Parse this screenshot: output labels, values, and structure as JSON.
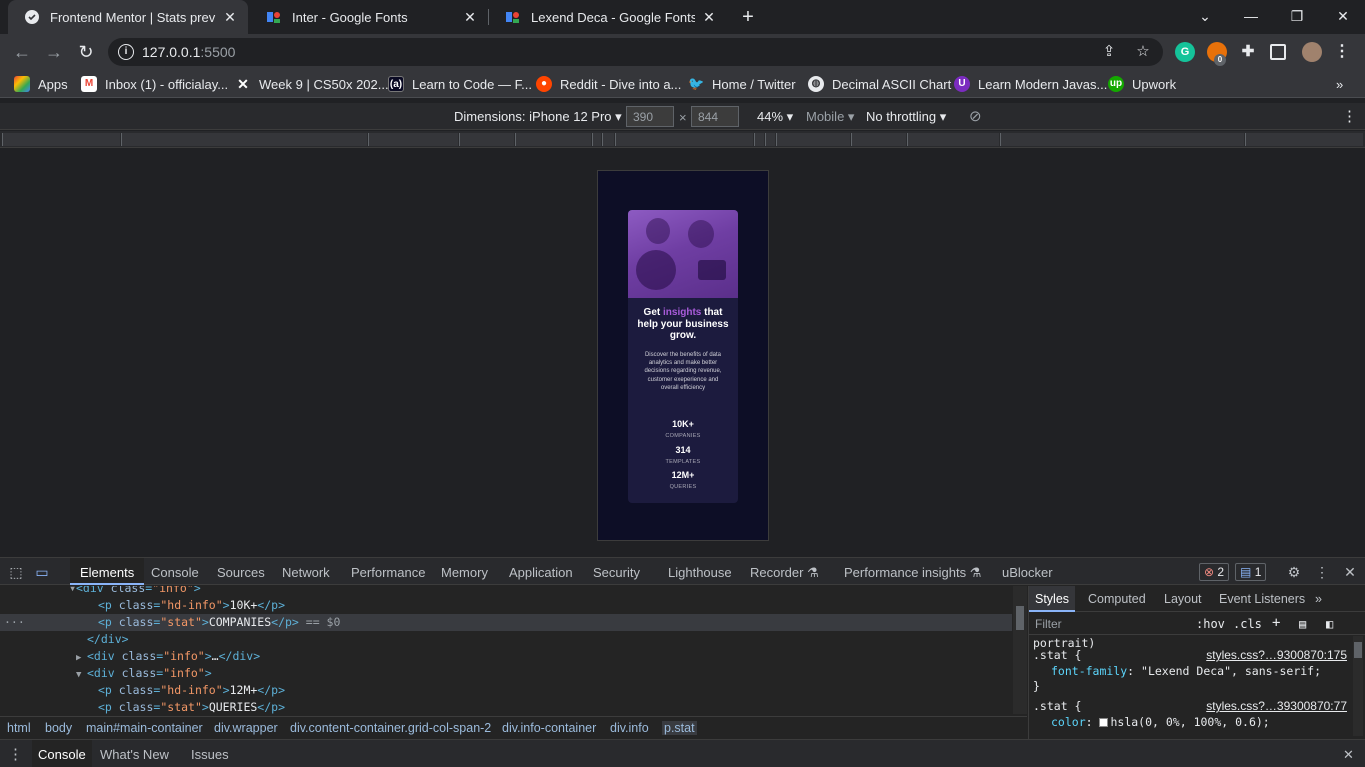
{
  "browser": {
    "tabs": [
      {
        "title": "Frontend Mentor | Stats preview c",
        "favicon": "globe-icon",
        "active": true
      },
      {
        "title": "Inter - Google Fonts",
        "favicon": "google-fonts-icon",
        "active": false
      },
      {
        "title": "Lexend Deca - Google Fonts",
        "favicon": "google-fonts-icon",
        "active": false
      }
    ],
    "new_tab": "+",
    "url_host": "127.0.0.1",
    "url_port": ":5500",
    "extension_badge": "0",
    "bookmarks": [
      {
        "label": "Apps",
        "icon": "apps-grid-icon"
      },
      {
        "label": "Inbox (1) - officialay...",
        "icon": "gmail-icon"
      },
      {
        "label": "Week 9 | CS50x 202...",
        "icon": "x-icon"
      },
      {
        "label": "Learn to Code — F...",
        "icon": "freecodecamp-icon"
      },
      {
        "label": "Reddit - Dive into a...",
        "icon": "reddit-icon"
      },
      {
        "label": "Home / Twitter",
        "icon": "twitter-icon"
      },
      {
        "label": "Decimal ASCII Chart",
        "icon": "globe-icon"
      },
      {
        "label": "Learn Modern Javas...",
        "icon": "course-icon"
      },
      {
        "label": "Upwork",
        "icon": "upwork-icon"
      }
    ]
  },
  "device_toolbar": {
    "dimensions_label": "Dimensions: iPhone 12 Pro",
    "width": "390",
    "times": "×",
    "height": "844",
    "zoom": "44%",
    "mode": "Mobile",
    "throttling": "No throttling"
  },
  "card": {
    "heading_pre": "Get ",
    "heading_accent": "insights",
    "heading_post": " that help your business grow.",
    "description": "Discover the benefits of data analytics and make better decisions regarding revenue, customer exeperience and overall efficiency",
    "stats": [
      {
        "value": "10K+",
        "label": "COMPANIES"
      },
      {
        "value": "314",
        "label": "TEMPLATES"
      },
      {
        "value": "12M+",
        "label": "QUERIES"
      }
    ],
    "accent_color": "#aa5cdb"
  },
  "devtools": {
    "tabs": [
      "Elements",
      "Console",
      "Sources",
      "Network",
      "Performance",
      "Memory",
      "Application",
      "Security",
      "Lighthouse",
      "Recorder",
      "Performance insights",
      "uBlocker"
    ],
    "errors": "2",
    "messages": "1",
    "dom_lines": [
      {
        "open": "<div ",
        "attr": "class",
        "val": "\"info\"",
        "close": ">",
        "text": "",
        "end": ""
      },
      {
        "open": "<p ",
        "attr": "class",
        "val": "\"hd-info\"",
        "close": ">",
        "text": "10K+",
        "end": "</p>"
      },
      {
        "open": "<p ",
        "attr": "class",
        "val": "\"stat\"",
        "close": ">",
        "text": "COMPANIES",
        "end": "</p>",
        "suffix": " == $0"
      },
      {
        "open": "</div>",
        "attr": "",
        "val": "",
        "close": "",
        "text": "",
        "end": ""
      },
      {
        "open": "<div ",
        "attr": "class",
        "val": "\"info\"",
        "close": ">",
        "text": "…",
        "end": "</div>"
      },
      {
        "open": "<div ",
        "attr": "class",
        "val": "\"info\"",
        "close": ">",
        "text": "",
        "end": ""
      },
      {
        "open": "<p ",
        "attr": "class",
        "val": "\"hd-info\"",
        "close": ">",
        "text": "12M+",
        "end": "</p>"
      },
      {
        "open": "<p ",
        "attr": "class",
        "val": "\"stat\"",
        "close": ">",
        "text": "QUERIES",
        "end": "</p>"
      }
    ],
    "breadcrumbs": [
      "html",
      "body",
      "main#main-container",
      "div.wrapper",
      "div.content-container.grid-col-span-2",
      "div.info-container",
      "div.info",
      "p.stat"
    ],
    "styles_tabs": [
      "Styles",
      "Computed",
      "Layout",
      "Event Listeners"
    ],
    "filter_placeholder": "Filter",
    "hov": ":hov",
    "cls": ".cls",
    "css_rules": {
      "prev_tail": "portrait)",
      "rule1_selector": ".stat {",
      "rule1_src": "styles.css?…9300870:175",
      "rule1_prop": "font-family",
      "rule1_value": ": \"Lexend Deca\", sans-serif;",
      "close": "}",
      "rule2_selector": ".stat {",
      "rule2_src": "styles.css?…39300870:77",
      "rule2_prop": "color",
      "rule2_value": "hsla(0, 0%, 100%, 0.6);"
    },
    "drawer_tabs": [
      "Console",
      "What's New",
      "Issues"
    ]
  }
}
